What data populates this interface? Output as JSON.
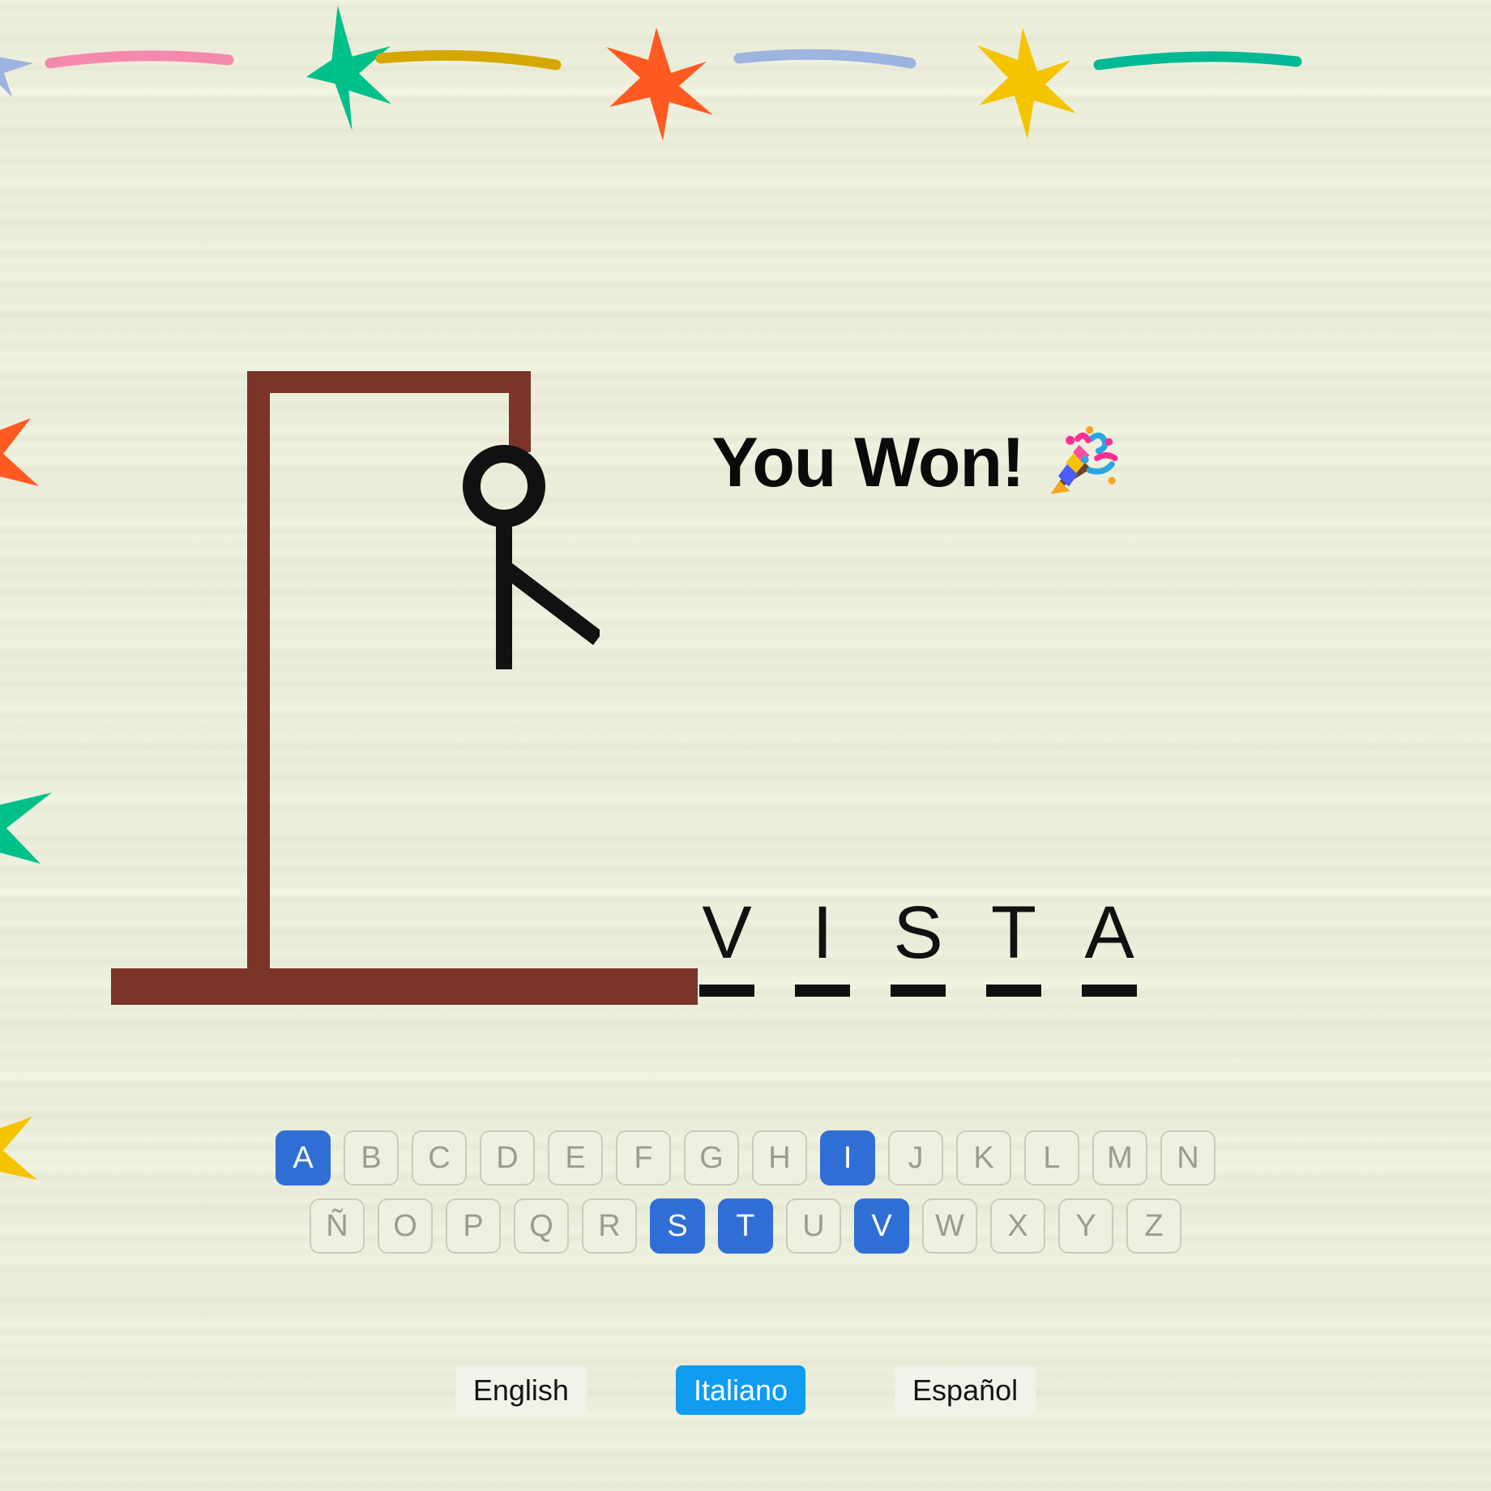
{
  "theme": {
    "background": "#f2f4e3",
    "wood_color": "#7b3427",
    "figure_color": "#111111",
    "key_used_color": "#2f6ed5",
    "lang_active_color": "#0e9bf0",
    "text_color": "#0a0a0a"
  },
  "result": {
    "text": "You Won!",
    "emoji_name": "party-popper"
  },
  "word": {
    "letters": [
      "V",
      "I",
      "S",
      "T",
      "A"
    ],
    "answer": "VISTA",
    "revealed": [
      true,
      true,
      true,
      true,
      true
    ]
  },
  "hangman": {
    "parts_drawn": [
      "gallows-top",
      "gallows-post",
      "gallows-base",
      "rope",
      "head",
      "body",
      "arm"
    ],
    "wrong_guesses": 0
  },
  "keyboard": {
    "rows": [
      [
        {
          "letter": "A",
          "used": true
        },
        {
          "letter": "B",
          "used": false
        },
        {
          "letter": "C",
          "used": false
        },
        {
          "letter": "D",
          "used": false
        },
        {
          "letter": "E",
          "used": false
        },
        {
          "letter": "F",
          "used": false
        },
        {
          "letter": "G",
          "used": false
        },
        {
          "letter": "H",
          "used": false
        },
        {
          "letter": "I",
          "used": true
        },
        {
          "letter": "J",
          "used": false
        },
        {
          "letter": "K",
          "used": false
        },
        {
          "letter": "L",
          "used": false
        },
        {
          "letter": "M",
          "used": false
        },
        {
          "letter": "N",
          "used": false
        }
      ],
      [
        {
          "letter": "Ñ",
          "used": false
        },
        {
          "letter": "O",
          "used": false
        },
        {
          "letter": "P",
          "used": false
        },
        {
          "letter": "Q",
          "used": false
        },
        {
          "letter": "R",
          "used": false
        },
        {
          "letter": "S",
          "used": true
        },
        {
          "letter": "T",
          "used": true
        },
        {
          "letter": "U",
          "used": false
        },
        {
          "letter": "V",
          "used": true
        },
        {
          "letter": "W",
          "used": false
        },
        {
          "letter": "X",
          "used": false
        },
        {
          "letter": "Y",
          "used": false
        },
        {
          "letter": "Z",
          "used": false
        }
      ]
    ]
  },
  "languages": [
    {
      "label": "English",
      "active": false
    },
    {
      "label": "Italiano",
      "active": true
    },
    {
      "label": "Español",
      "active": false
    }
  ],
  "confetti": {
    "star_colors": [
      "#00c08a",
      "#ff5a22",
      "#f5c400",
      "#9db3e0",
      "#f589ad"
    ],
    "streak_colors": [
      "#f589ad",
      "#d4a800",
      "#9db3e0",
      "#00b894"
    ]
  }
}
